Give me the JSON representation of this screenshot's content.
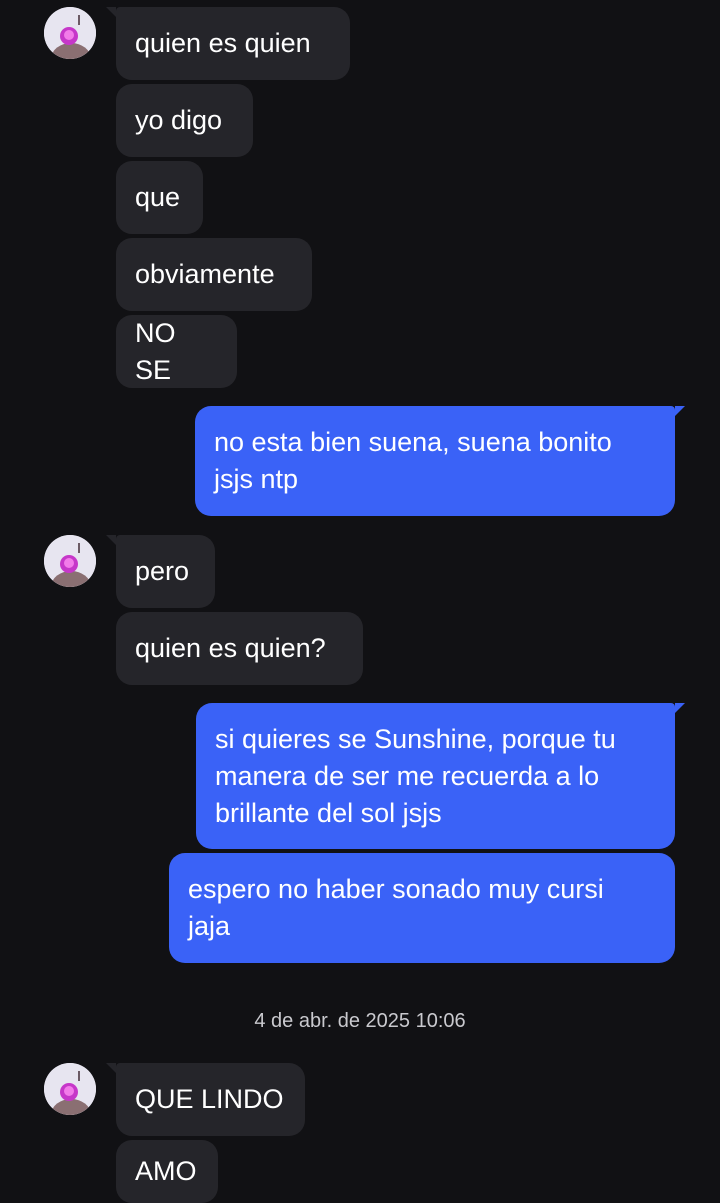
{
  "conversation": {
    "group1": [
      "quien es quien",
      "yo digo",
      "que",
      "obviamente",
      "NO SE"
    ],
    "sent1": "no esta bien suena, suena bonito\njsjs ntp",
    "group2": [
      "pero",
      "quien es quien?"
    ],
    "sent2": "si quieres se Sunshine, porque tu\nmanera de ser me recuerda a lo\nbrillante del sol jsjs",
    "sent3": "espero no haber sonado muy cursi\njaja",
    "timestamp": "4 de abr. de 2025 10:06",
    "group3": [
      "QUE LINDO",
      "AMO"
    ]
  },
  "colors": {
    "background": "#111114",
    "incoming_bubble": "#25252a",
    "outgoing_bubble": "#3a62f7",
    "timestamp_text": "#c9c9ce"
  },
  "icons": {
    "contact_avatar": "profile-photo"
  }
}
